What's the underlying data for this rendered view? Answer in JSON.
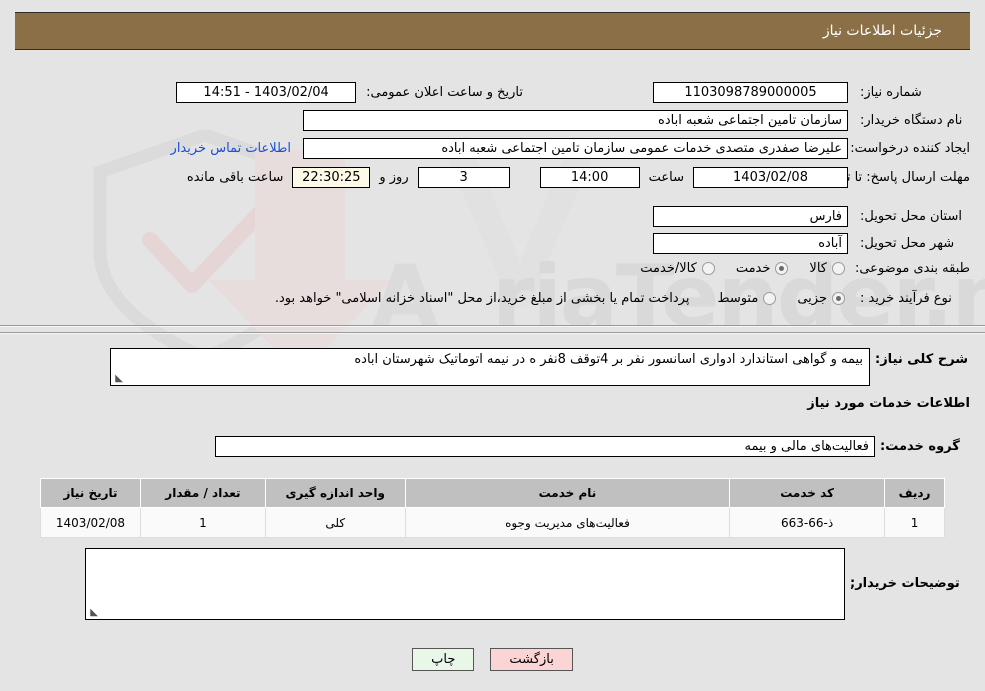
{
  "header": {
    "title": "جزئیات اطلاعات نیاز"
  },
  "form": {
    "need_number_label": "شماره نیاز:",
    "need_number_value": "1103098789000005",
    "announce_datetime_label": "تاریخ و ساعت اعلان عمومی:",
    "announce_datetime_value": "1403/02/04 - 14:51",
    "buyer_org_label": "نام دستگاه خریدار:",
    "buyer_org_value": "سازمان تامین اجتماعی شعبه اباده",
    "creator_label": "ایجاد کننده درخواست:",
    "creator_value": "علیرضا صفدری متصدی خدمات عمومی سازمان تامین اجتماعی شعبه اباده",
    "contact_link": "اطلاعات تماس خریدار",
    "deadline_label": "مهلت ارسال پاسخ: تا تاریخ:",
    "deadline_date": "1403/02/08",
    "hour_label": "ساعت",
    "hour_value": "14:00",
    "days_value": "3",
    "days_label": "روز و",
    "countdown_value": "22:30:25",
    "remaining_label": "ساعت باقی مانده",
    "province_label": "استان محل تحویل:",
    "province_value": "فارس",
    "city_label": "شهر محل تحویل:",
    "city_value": "آباده",
    "category_label": "طبقه بندی موضوعی:",
    "category_options": [
      {
        "label": "کالا",
        "selected": false
      },
      {
        "label": "خدمت",
        "selected": true
      },
      {
        "label": "کالا/خدمت",
        "selected": false
      }
    ],
    "purchase_type_label": "نوع فرآیند خرید :",
    "purchase_type_options": [
      {
        "label": "جزیی",
        "selected": true
      },
      {
        "label": "متوسط",
        "selected": false
      }
    ],
    "payment_note": "پرداخت تمام یا بخشی از مبلغ خرید،از محل \"اسناد خزانه اسلامی\" خواهد بود."
  },
  "summary": {
    "label": "شرح کلی نیاز:",
    "value": "بیمه و گواهی استاندارد  ادواری اسانسور نفر بر 4توقف 8نفر ه در نیمه اتوماتیک شهرستان اباده"
  },
  "services": {
    "section_title": "اطلاعات خدمات مورد نیاز",
    "group_label": "گروه خدمت:",
    "group_value": "فعالیت‌های مالی و بیمه",
    "columns": [
      "ردیف",
      "کد خدمت",
      "نام خدمت",
      "واحد اندازه گیری",
      "تعداد / مقدار",
      "تاریخ نیاز"
    ],
    "rows": [
      {
        "index": "1",
        "code": "ذ-66-663",
        "name": "فعالیت‌های مدیریت وجوه",
        "unit": "کلی",
        "quantity": "1",
        "date": "1403/02/08"
      }
    ]
  },
  "buyer_notes": {
    "label": "توضیحات خریدار;",
    "value": ""
  },
  "footer": {
    "print_label": "چاپ",
    "back_label": "بازگشت"
  },
  "watermark": {
    "text": "AriaTender.net"
  },
  "colors": {
    "header_bg": "#8b6f47",
    "page_bg": "#e4e4e4",
    "link": "#1a4fd6",
    "print_btn": "#e9f7e9",
    "back_btn": "#fbd5d5",
    "table_header": "#c0c0c0"
  }
}
